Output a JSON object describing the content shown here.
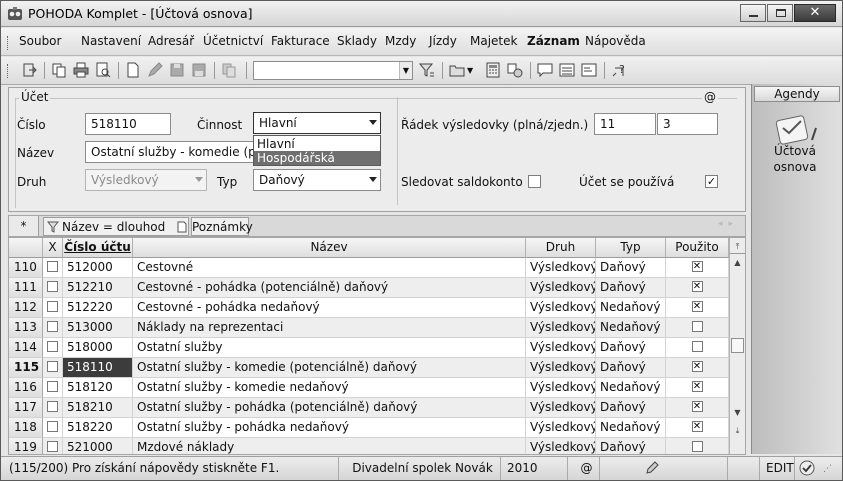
{
  "window": {
    "title": "POHODA Komplet - [Účtová osnova]",
    "close_glyph": "✕"
  },
  "menu": [
    "Soubor",
    "Nastavení",
    "Adresář",
    "Účetnictví",
    "Fakturace",
    "Sklady",
    "Mzdy",
    "Jízdy",
    "Majetek",
    "Záznam",
    "Nápověda"
  ],
  "toolbar": {
    "combo_value": ""
  },
  "form": {
    "section_label": "Účet",
    "at_label": "@",
    "cislo_label": "Číslo",
    "cislo_value": "518110",
    "cinnost_label": "Činnost",
    "cinnost_value": "Hlavní",
    "cinnost_options": [
      "Hlavní",
      "Hospodářská"
    ],
    "cinnost_highlighted": "Hospodářská",
    "nazev_label": "Název",
    "nazev_value": "Ostatní služby - komedie  (potenciálně) daňový",
    "druh_label": "Druh",
    "druh_value": "Výsledkový",
    "typ_label": "Typ",
    "typ_value": "Daňový",
    "radek_label": "Řádek výsledovky (plná/zjedn.)",
    "radek_plna": "11",
    "radek_zjedn": "3",
    "saldokonto_label": "Sledovat saldokonto",
    "saldokonto_checked": false,
    "pouziva_label": "Účet se používá",
    "pouziva_checked": true
  },
  "agendy": {
    "title": "Agendy",
    "item_line1": "Účtová",
    "item_line2": "osnova"
  },
  "tabs": {
    "star": "*",
    "filter_tab": "Název = dlouhod",
    "notes_tab": "Poznámky"
  },
  "grid": {
    "headers": {
      "x": "X",
      "cislo": "Číslo účtu",
      "nazev": "Název",
      "druh": "Druh",
      "typ": "Typ",
      "pouzito": "Použito"
    },
    "rows": [
      {
        "n": "110",
        "cislo": "512000",
        "nazev": "Cestovné",
        "druh": "Výsledkový",
        "typ": "Daňový",
        "pouzito": true
      },
      {
        "n": "111",
        "cislo": "512210",
        "nazev": "Cestovné - pohádka    (potenciálně) daňový",
        "druh": "Výsledkový",
        "typ": "Daňový",
        "pouzito": true
      },
      {
        "n": "112",
        "cislo": "512220",
        "nazev": "Cestovné - pohádka    nedaňový",
        "druh": "Výsledkový",
        "typ": "Nedaňový",
        "pouzito": true
      },
      {
        "n": "113",
        "cislo": "513000",
        "nazev": "Náklady na reprezentaci",
        "druh": "Výsledkový",
        "typ": "Nedaňový",
        "pouzito": false
      },
      {
        "n": "114",
        "cislo": "518000",
        "nazev": "Ostatní služby",
        "druh": "Výsledkový",
        "typ": "Daňový",
        "pouzito": false
      },
      {
        "n": "115",
        "cislo": "518110",
        "nazev": "Ostatní služby - komedie  (potenciálně) daňový",
        "druh": "Výsledkový",
        "typ": "Daňový",
        "pouzito": true
      },
      {
        "n": "116",
        "cislo": "518120",
        "nazev": "Ostatní služby - komedie  nedaňový",
        "druh": "Výsledkový",
        "typ": "Nedaňový",
        "pouzito": true
      },
      {
        "n": "117",
        "cislo": "518210",
        "nazev": "Ostatní služby - pohádka  (potenciálně) daňový",
        "druh": "Výsledkový",
        "typ": "Daňový",
        "pouzito": true
      },
      {
        "n": "118",
        "cislo": "518220",
        "nazev": "Ostatní služby - pohádka   nedaňový",
        "druh": "Výsledkový",
        "typ": "Nedaňový",
        "pouzito": true
      },
      {
        "n": "119",
        "cislo": "521000",
        "nazev": "Mzdové náklady",
        "druh": "Výsledkový",
        "typ": "Daňový",
        "pouzito": false
      }
    ],
    "current_row_index": 5
  },
  "status": {
    "help": "(115/200) Pro získání nápovědy stiskněte F1.",
    "company": "Divadelní spolek Novák",
    "year": "2010",
    "at": "@",
    "mode": "EDIT"
  }
}
